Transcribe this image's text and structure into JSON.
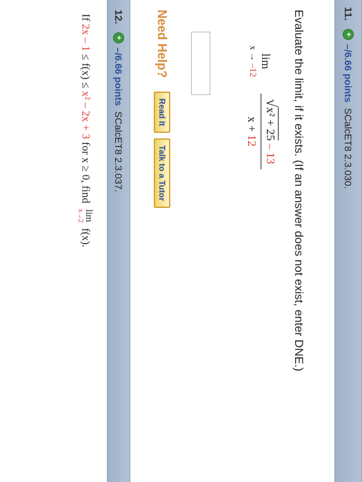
{
  "q11": {
    "number": "11.",
    "points": "–/6.66 points",
    "code": "SCalcET8 2.3.030.",
    "instruction": "Evaluate the limit, if it exists. (If an answer does not exist, enter DNE.)",
    "lim_word": "lim",
    "lim_sub_prefix": "x → ",
    "lim_sub_value": "–12",
    "numerator_radicand": "x² + 25",
    "numerator_tail": " – 13",
    "denominator_prefix": "x + ",
    "denominator_value": "12",
    "help_label": "Need Help?",
    "read_it": "Read It",
    "talk_to_tutor": "Talk to a Tutor"
  },
  "q12": {
    "number": "12.",
    "points": "–/6.66 points",
    "code": "SCalcET8 2.3.037.",
    "text_part1": "If ",
    "expr_left": "2x – 1",
    "text_part2": " ≤ f(x) ≤ ",
    "expr_right": "x² – 2x + 3",
    "text_part3": " for x ≥ 0, find ",
    "lim_word": "lim",
    "lim_sub": "x→2",
    "text_part4": " f(x)."
  }
}
